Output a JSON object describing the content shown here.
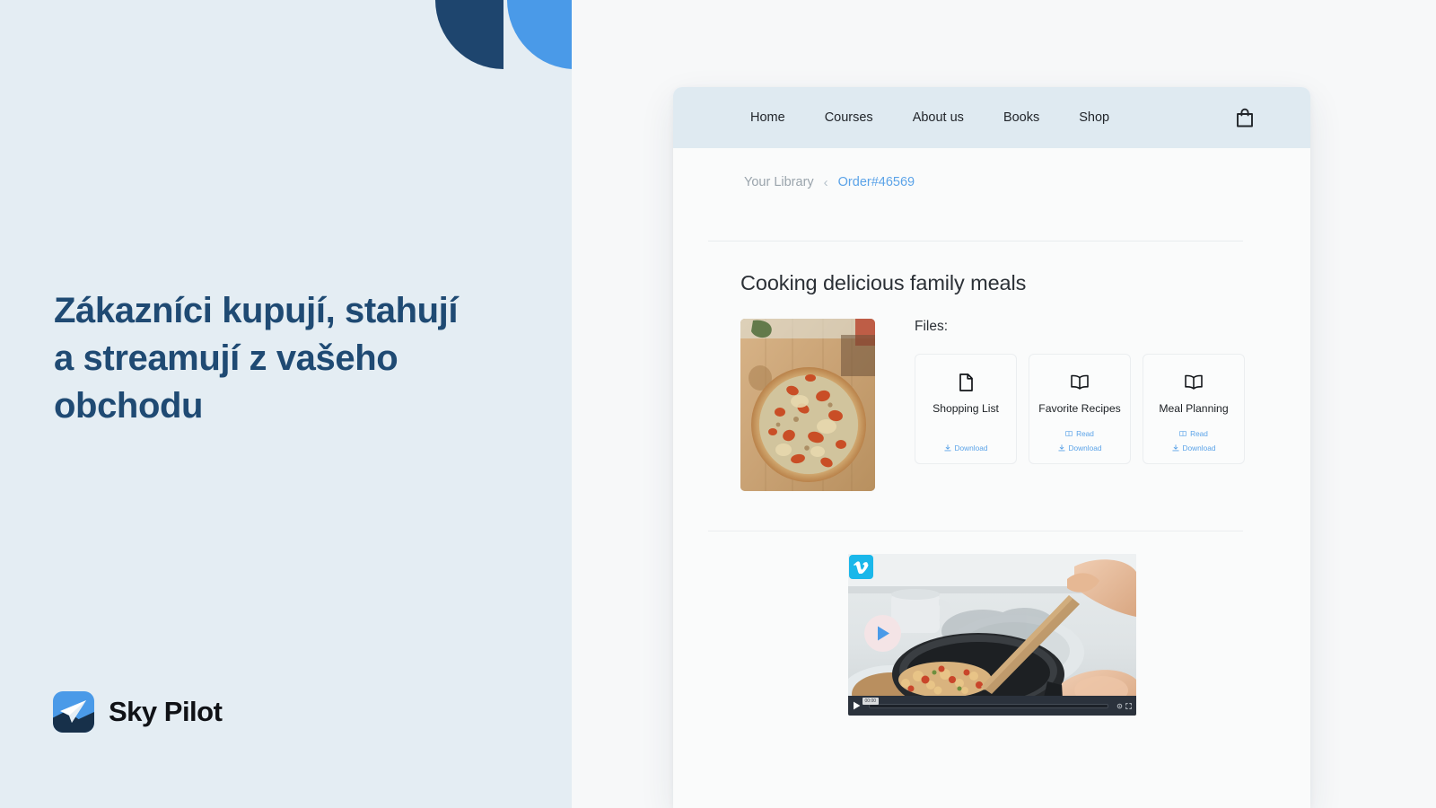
{
  "hero": {
    "headline": "Zákazníci kupují, stahují a streamují z vašeho obchodu",
    "brand_name": "Sky Pilot",
    "accent_dark": "#1e456e",
    "accent_light": "#4a9ae8",
    "panel_bg": "#e4edf3",
    "decor": [
      {
        "name": "dark-half-circle",
        "color": "#1e456e"
      },
      {
        "name": "light-half-circle",
        "color": "#4a9ae8"
      }
    ]
  },
  "storefront": {
    "nav": {
      "items": [
        {
          "label": "Home"
        },
        {
          "label": "Courses"
        },
        {
          "label": "About us"
        },
        {
          "label": "Books"
        },
        {
          "label": "Shop"
        }
      ],
      "cart_icon": "shopping-bag-icon",
      "bg": "#dfeaf1"
    },
    "breadcrumb": {
      "parent": "Your Library",
      "separator": "‹",
      "current": "Order#46569",
      "current_color": "#5ba3e8",
      "parent_color": "#9aa4ac"
    },
    "product": {
      "title": "Cooking delicious family meals",
      "thumbnail_alt": "pizza-on-cutting-board",
      "files_label": "Files:",
      "files": [
        {
          "name": "Shopping List",
          "icon": "document-icon",
          "actions": [
            {
              "label": "Download",
              "icon": "download-icon"
            }
          ]
        },
        {
          "name": "Favorite Recipes",
          "icon": "open-book-icon",
          "actions": [
            {
              "label": "Read",
              "icon": "book-icon"
            },
            {
              "label": "Download",
              "icon": "download-icon"
            }
          ]
        },
        {
          "name": "Meal Planning",
          "icon": "open-book-icon",
          "actions": [
            {
              "label": "Read",
              "icon": "book-icon"
            },
            {
              "label": "Download",
              "icon": "download-icon"
            }
          ]
        }
      ]
    },
    "video": {
      "provider": "Vimeo",
      "provider_icon": "vimeo-logo-icon",
      "poster_alt": "hands-stirring-food-in-pan",
      "play_label": "Play",
      "timecode": "00:00",
      "controls": [
        "play-icon",
        "progress-bar",
        "settings-icon",
        "fullscreen-icon"
      ]
    }
  }
}
